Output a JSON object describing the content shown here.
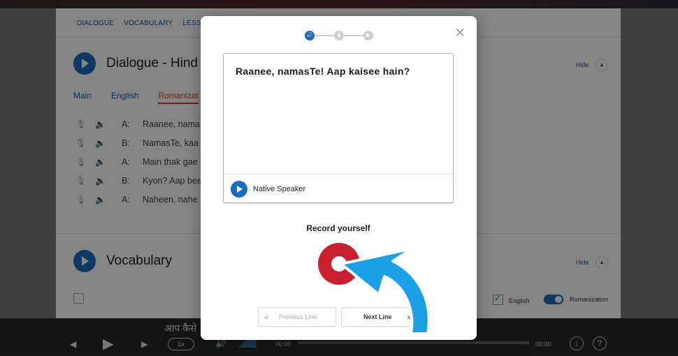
{
  "tabs": [
    "DIALOGUE",
    "VOCABULARY",
    "LESSO"
  ],
  "dialogue_section": {
    "title": "Dialogue - Hind",
    "hide_label": "Hide",
    "subtabs": [
      "Main",
      "English",
      "Romanizat"
    ],
    "rows": [
      {
        "speaker": "A:",
        "text": "Raanee, nama"
      },
      {
        "speaker": "B:",
        "text": "NamasTe, kaa"
      },
      {
        "speaker": "A:",
        "text": "Main thak gae"
      },
      {
        "speaker": "B:",
        "text": "Kyon? Aap bee"
      },
      {
        "speaker": "A:",
        "text": "Naheen, nahe"
      }
    ]
  },
  "vocab_section": {
    "title": "Vocabulary",
    "hide_label": "Hide",
    "english_label": "English",
    "romanization_label": "Romanization"
  },
  "player": {
    "hindi_text": "आप कैसे",
    "speed": "1x",
    "time_start": "00:00",
    "time_end": "00:00",
    "progress": 0
  },
  "modal": {
    "line_text": "Raanee, namasTe! Aap kaisee hain?",
    "native_label": "Native Speaker",
    "record_label": "Record yourself",
    "prev_label": "Previous Line",
    "next_label": "Next Line",
    "current_step": 1,
    "steps": 3
  },
  "colors": {
    "accent": "#1c6bbd",
    "record": "#c8202e",
    "arrow": "#1aa0e6",
    "active_tab": "#d0492a"
  },
  "icons": {
    "mic": "microphone-icon",
    "speaker": "speaker-icon",
    "play": "play-icon",
    "close": "close-icon",
    "download": "download-icon",
    "help": "help-icon"
  }
}
